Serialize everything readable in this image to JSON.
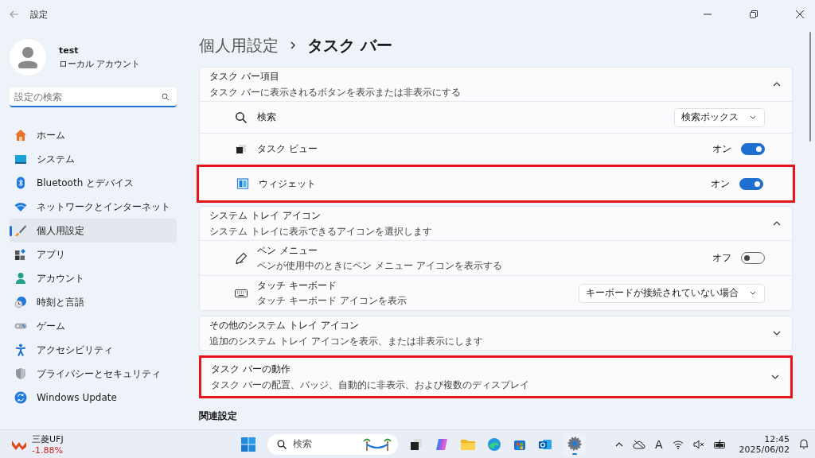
{
  "window": {
    "title": "設定"
  },
  "user": {
    "name": "test",
    "account_type": "ローカル アカウント"
  },
  "search": {
    "placeholder": "設定の検索"
  },
  "sidebar": {
    "items": [
      {
        "label": "ホーム",
        "selected": false
      },
      {
        "label": "システム",
        "selected": false
      },
      {
        "label": "Bluetooth とデバイス",
        "selected": false
      },
      {
        "label": "ネットワークとインターネット",
        "selected": false
      },
      {
        "label": "個人用設定",
        "selected": true
      },
      {
        "label": "アプリ",
        "selected": false
      },
      {
        "label": "アカウント",
        "selected": false
      },
      {
        "label": "時刻と言語",
        "selected": false
      },
      {
        "label": "ゲーム",
        "selected": false
      },
      {
        "label": "アクセシビリティ",
        "selected": false
      },
      {
        "label": "プライバシーとセキュリティ",
        "selected": false
      },
      {
        "label": "Windows Update",
        "selected": false
      }
    ]
  },
  "breadcrumb": [
    "個人用設定",
    "タスク バー"
  ],
  "sections": [
    {
      "title": "タスク バー項目",
      "subtitle": "タスク バーに表示されるボタンを表示または非表示にする",
      "expanded": true,
      "highlighted": false,
      "rows": [
        {
          "kind": "dropdown",
          "label": "検索",
          "value": "検索ボックス",
          "highlighted": false
        },
        {
          "kind": "toggle",
          "label": "タスク ビュー",
          "state_label": "オン",
          "on": true,
          "highlighted": false
        },
        {
          "kind": "toggle",
          "label": "ウィジェット",
          "state_label": "オン",
          "on": true,
          "highlighted": true
        }
      ]
    },
    {
      "title": "システム トレイ アイコン",
      "subtitle": "システム トレイに表示できるアイコンを選択します",
      "expanded": true,
      "highlighted": false,
      "rows": [
        {
          "kind": "toggle",
          "label": "ペン メニュー",
          "description": "ペンが使用中のときにペン メニュー アイコンを表示する",
          "state_label": "オフ",
          "on": false,
          "highlighted": false
        },
        {
          "kind": "dropdown",
          "label": "タッチ キーボード",
          "description": "タッチ キーボード アイコンを表示",
          "value": "キーボードが接続されていない場合",
          "highlighted": false
        }
      ]
    },
    {
      "title": "その他のシステム トレイ アイコン",
      "subtitle": "追加のシステム トレイ アイコンを表示、または非表示にします",
      "expanded": false,
      "highlighted": false
    },
    {
      "title": "タスク バーの動作",
      "subtitle": "タスク バーの配置、バッジ、自動的に非表示、および複数のディスプレイ",
      "expanded": false,
      "highlighted": true
    }
  ],
  "related_heading": "関連設定",
  "taskbar": {
    "stock": {
      "name": "三菱UFJ",
      "change": "-1.88%"
    },
    "search": {
      "placeholder": "検索"
    },
    "ime": "A",
    "time": "12:45",
    "date": "2025/06/02"
  }
}
